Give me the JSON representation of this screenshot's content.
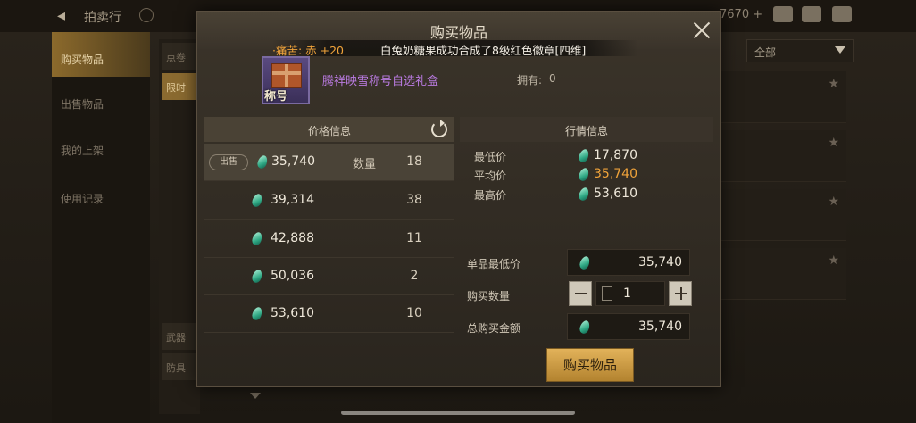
{
  "background": {
    "title": "拍卖行",
    "currency": "7670 +",
    "sidebar": [
      "购买物品",
      "出售物品",
      "我的上架",
      "使用记录"
    ],
    "filter": "全部",
    "col2_items": [
      "点卷",
      "限时",
      "武器",
      "防具"
    ]
  },
  "modal": {
    "title": "购买物品",
    "broadcast": {
      "left": "·痛苦: 赤 +20",
      "right": "白兔奶糖果成功合成了8级红色徽章[四维]"
    },
    "item": {
      "name": "腾祥映雪称号自选礼盒",
      "badge": "称号",
      "owned_label": "拥有:",
      "owned_value": "0"
    },
    "price_panel": {
      "title": "价格信息",
      "sell_tag": "出售",
      "qty_label": "数量",
      "rows": [
        {
          "price": "35,740",
          "qty": "18"
        },
        {
          "price": "39,314",
          "qty": "38"
        },
        {
          "price": "42,888",
          "qty": "11"
        },
        {
          "price": "50,036",
          "qty": "2"
        },
        {
          "price": "53,610",
          "qty": "10"
        }
      ]
    },
    "market_panel": {
      "title": "行情信息",
      "min_label": "最低价",
      "min_value": "17,870",
      "avg_label": "平均价",
      "avg_value": "35,740",
      "max_label": "最高价",
      "max_value": "53,610"
    },
    "form": {
      "unit_min_label": "单品最低价",
      "unit_min_value": "35,740",
      "buy_qty_label": "购买数量",
      "buy_qty_value": "1",
      "total_label": "总购买金额",
      "total_value": "35,740"
    },
    "buy_button": "购买物品"
  },
  "colors": {
    "accent_gold": "#e2b25a",
    "price_orange": "#f0a33a",
    "item_purple": "#b97ae0",
    "gem_green": "#2fa884"
  }
}
